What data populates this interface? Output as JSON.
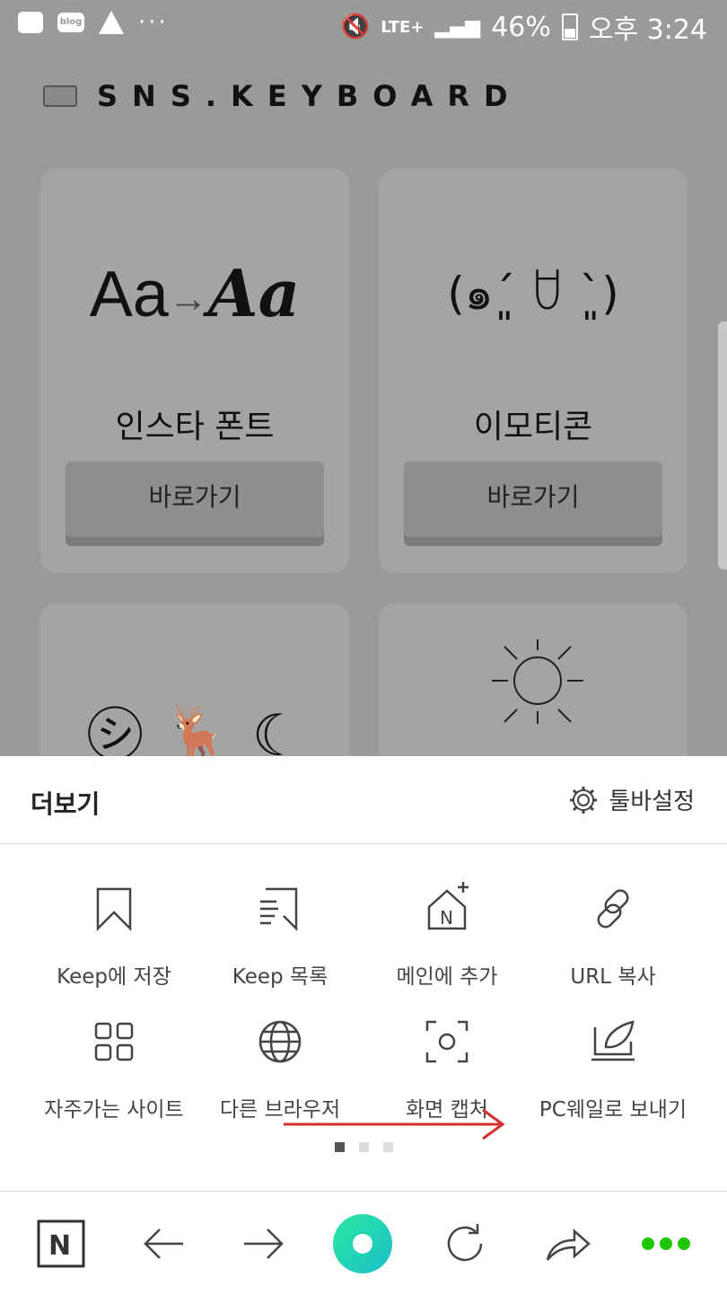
{
  "status_bar": {
    "battery": "46%",
    "time": "오후 3:24",
    "network": "LTE+"
  },
  "page": {
    "brand": "SNS.KEYBOARD",
    "cards": [
      {
        "art": "Aa→Aa",
        "title": "인스타 폰트",
        "button": "바로가기"
      },
      {
        "art": "(๑ˊ͈ ꇴ ˋ͈)",
        "title": "이모티콘",
        "button": "바로가기"
      }
    ]
  },
  "sheet": {
    "title": "더보기",
    "toolbar_settings": "툴바설정",
    "items": [
      {
        "label": "Keep에 저장",
        "icon": "bookmark-icon"
      },
      {
        "label": "Keep 목록",
        "icon": "keep-list-icon"
      },
      {
        "label": "메인에 추가",
        "icon": "add-to-home-icon"
      },
      {
        "label": "URL 복사",
        "icon": "link-icon"
      },
      {
        "label": "자주가는 사이트",
        "icon": "grid-icon"
      },
      {
        "label": "다른 브라우저",
        "icon": "globe-icon"
      },
      {
        "label": "화면 캡처",
        "icon": "screen-capture-icon"
      },
      {
        "label": "PC웨일로 보내기",
        "icon": "send-to-pc-icon"
      }
    ],
    "page_indicator": {
      "current": 1,
      "total": 3
    }
  },
  "nav": {
    "buttons": [
      "naver-home-icon",
      "back-icon",
      "forward-icon",
      "green-dot-icon",
      "refresh-icon",
      "share-icon",
      "more-icon"
    ],
    "accent": "#1ec800"
  }
}
